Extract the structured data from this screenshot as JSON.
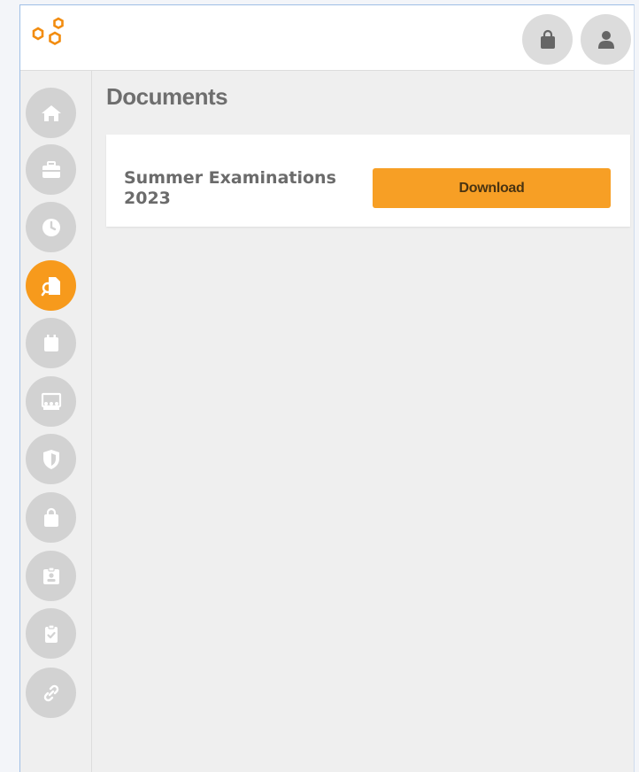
{
  "header": {
    "logo_icon": "hexagon-logo-icon",
    "actions": [
      {
        "icon": "shopping-bag-icon"
      },
      {
        "icon": "user-icon"
      }
    ]
  },
  "sidebar": {
    "items": [
      {
        "icon": "home-icon",
        "active": false
      },
      {
        "icon": "briefcase-icon",
        "active": false
      },
      {
        "icon": "clock-icon",
        "active": false
      },
      {
        "icon": "documents-icon",
        "active": true
      },
      {
        "icon": "calendar-icon",
        "active": false
      },
      {
        "icon": "presentation-icon",
        "active": false
      },
      {
        "icon": "shield-icon",
        "active": false
      },
      {
        "icon": "shopping-bag-icon",
        "active": false
      },
      {
        "icon": "id-badge-icon",
        "active": false
      },
      {
        "icon": "clipboard-check-icon",
        "active": false
      },
      {
        "icon": "link-icon",
        "active": false
      }
    ],
    "active_color": "#f79a1c",
    "inactive_color": "#d2d2d2"
  },
  "main": {
    "title": "Documents",
    "documents": [
      {
        "name": "Summer Examinations 2023",
        "action_label": "Download"
      }
    ]
  },
  "colors": {
    "accent": "#f79f25",
    "logo": "#f28c0f"
  }
}
